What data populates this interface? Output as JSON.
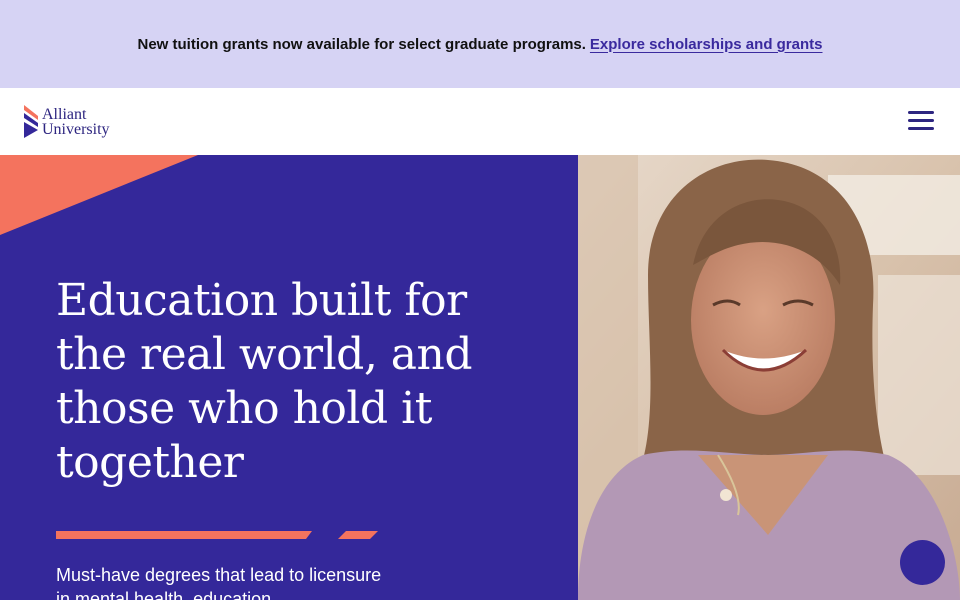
{
  "banner": {
    "text": "New tuition grants now available for select graduate programs.",
    "link_label": "Explore scholarships and grants"
  },
  "header": {
    "logo_line1": "Alliant",
    "logo_line2": "University",
    "menu_icon": "hamburger-menu-icon"
  },
  "hero": {
    "title": "Education built for the real world, and those who hold it together",
    "subtitle": "Must-have degrees that lead to licensure in mental health, education,"
  },
  "chat": {
    "icon": "chat-launcher-icon"
  },
  "colors": {
    "banner_bg": "#d6d3f4",
    "brand_purple": "#34289a",
    "accent_coral": "#f4735e",
    "link": "#3a2a9e"
  }
}
